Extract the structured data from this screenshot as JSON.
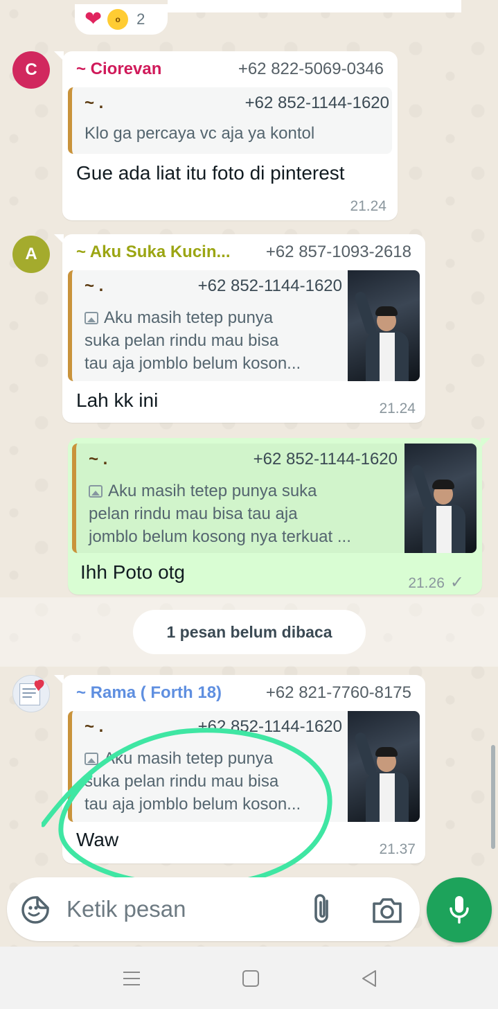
{
  "reactions": {
    "emojis": [
      "heart",
      "wow"
    ],
    "count": "2"
  },
  "messages": [
    {
      "sender": "~ Ciorevan",
      "sender_color": "#d01a5a",
      "phone": "+62 822-5069-0346",
      "avatar_letter": "C",
      "avatar_color": "#d1285e",
      "quote": {
        "name": "~ .",
        "phone": "+62 852-1144-1620",
        "text": "Klo ga percaya vc aja ya kontol"
      },
      "text": "Gue ada liat itu foto di pinterest",
      "time": "21.24"
    },
    {
      "sender": "~ Aku Suka Kucin...",
      "sender_color": "#9ba513",
      "phone": "+62 857-1093-2618",
      "avatar_letter": "A",
      "avatar_color": "#a4ab2d",
      "quote": {
        "name": "~ .",
        "phone": "+62 852-1144-1620",
        "lines": [
          "Aku masih tetep punya",
          "suka pelan rindu mau bisa",
          "tau aja jomblo belum koson..."
        ]
      },
      "text": "Lah kk ini",
      "time": "21.24"
    },
    {
      "outgoing": true,
      "quote": {
        "name": "~ .",
        "phone": "+62 852-1144-1620",
        "lines": [
          "Aku masih tetep punya suka",
          "pelan rindu mau bisa tau aja",
          "jomblo belum kosong nya terkuat ..."
        ]
      },
      "text": "Ihh Poto otg",
      "time": "21.26",
      "status_icon": "check-icon"
    },
    {
      "sender": "~ Rama ( Forth 18)",
      "sender_color": "#5f8fe0",
      "phone": "+62 821-7760-8175",
      "quote": {
        "name": "~ .",
        "phone": "+62 852-1144-1620",
        "lines": [
          "Aku masih tetep punya",
          "suka pelan rindu mau bisa",
          "tau aja jomblo belum koson..."
        ]
      },
      "text": "Waw",
      "time": "21.37"
    }
  ],
  "unread_divider": "1 pesan belum dibaca",
  "composer": {
    "placeholder": "Ketik pesan"
  },
  "colors": {
    "accent_green": "#1da35b",
    "outgoing_bubble": "#d9fdd3",
    "quote_bar": "#c9933b",
    "annotation": "#3fe6a3"
  }
}
